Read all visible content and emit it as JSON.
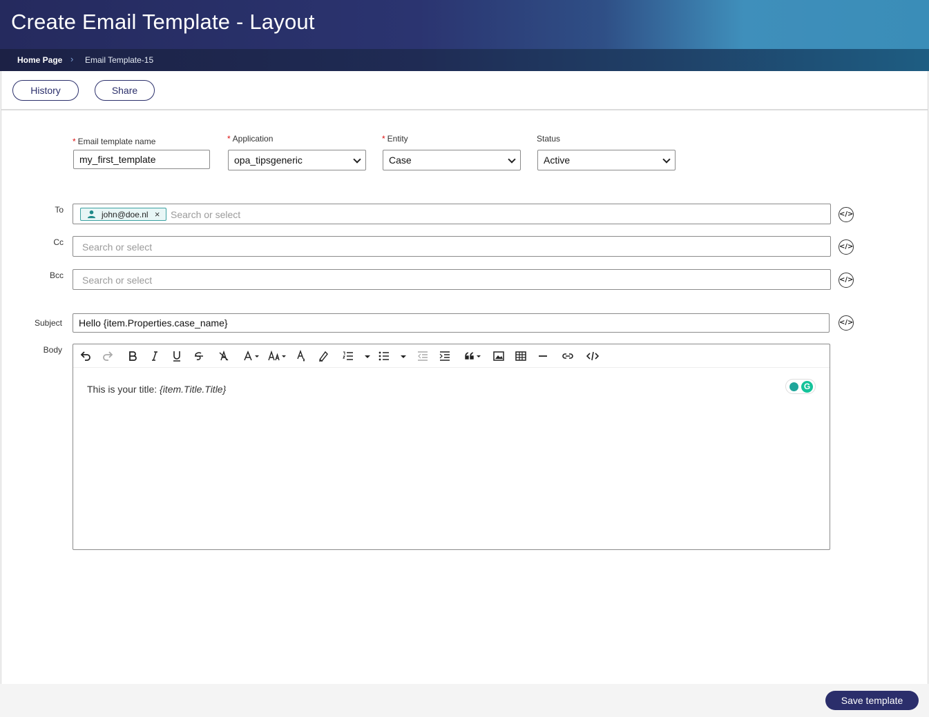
{
  "header": {
    "title": "Create Email Template - Layout",
    "breadcrumb": {
      "home": "Home Page",
      "separator": "›",
      "current": "Email Template-15"
    }
  },
  "actions": {
    "history": "History",
    "share": "Share"
  },
  "form": {
    "name": {
      "label": "Email template name",
      "value": "my_first_template",
      "required": true
    },
    "application": {
      "label": "Application",
      "value": "opa_tipsgeneric",
      "required": true
    },
    "entity": {
      "label": "Entity",
      "value": "Case",
      "required": true
    },
    "status": {
      "label": "Status",
      "value": "Active",
      "required": false
    },
    "required_mark": "*"
  },
  "recipients": {
    "to": {
      "label": "To",
      "chips": [
        "john@doe.nl"
      ],
      "placeholder": "Search or select"
    },
    "cc": {
      "label": "Cc",
      "placeholder": "Search or select"
    },
    "bcc": {
      "label": "Bcc",
      "placeholder": "Search or select"
    },
    "chip_remove": "×"
  },
  "subject": {
    "label": "Subject",
    "value": "Hello {item.Properties.case_name}"
  },
  "body": {
    "label": "Body",
    "text": "This is your title: ",
    "variable": "{item.Title.Title}"
  },
  "toolbar_icons": [
    "undo-icon",
    "redo-icon",
    "bold-icon",
    "italic-icon",
    "underline-icon",
    "strikethrough-icon",
    "clear-format-icon",
    "font-color-icon",
    "font-size-icon",
    "text-color-icon",
    "highlight-icon",
    "numbered-list-icon",
    "bullet-list-icon",
    "outdent-icon",
    "indent-icon",
    "quote-icon",
    "image-icon",
    "table-icon",
    "horizontal-rule-icon",
    "link-icon",
    "source-code-icon"
  ],
  "code_button": "</>",
  "footer": {
    "save": "Save template"
  },
  "colors": {
    "primary": "#2b2e6b",
    "chip_border": "#3aa0a0",
    "required": "#dd1111"
  }
}
